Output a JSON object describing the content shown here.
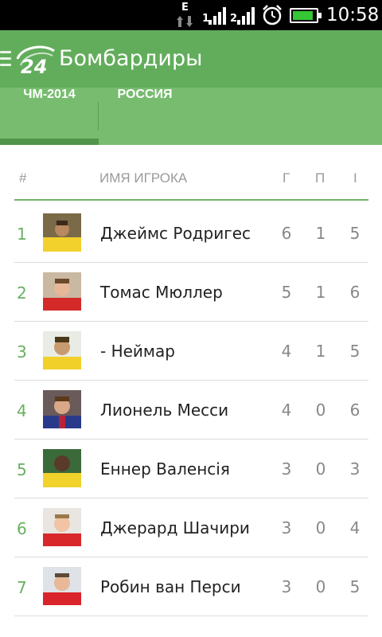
{
  "status_bar": {
    "network_type": "E",
    "sim1_label": "1",
    "sim2_label": "2",
    "time": "10:58",
    "battery_level": 0.9,
    "icons": [
      "data-activity-icon",
      "signal-icon",
      "signal-icon",
      "alarm-icon",
      "battery-icon"
    ]
  },
  "app_bar": {
    "title": "Бомбардиры",
    "logo": "24-logo"
  },
  "tabs": [
    {
      "label": "ЧМ-2014",
      "selected": true
    },
    {
      "label": "РОССИЯ",
      "selected": false
    }
  ],
  "table": {
    "headers": {
      "number": "#",
      "name": "ИМЯ ИГРОКА",
      "goals": "Г",
      "assists": "П",
      "games": "I"
    },
    "rows": [
      {
        "pos": "1",
        "name": "Джеймс Родригес",
        "goals": "6",
        "assists": "1",
        "games": "5"
      },
      {
        "pos": "2",
        "name": "Томас Мюллер",
        "goals": "5",
        "assists": "1",
        "games": "6"
      },
      {
        "pos": "3",
        "name": "- Неймар",
        "goals": "4",
        "assists": "1",
        "games": "5"
      },
      {
        "pos": "4",
        "name": "Лионель Месси",
        "goals": "4",
        "assists": "0",
        "games": "6"
      },
      {
        "pos": "5",
        "name": "Еннер Валенсія",
        "goals": "3",
        "assists": "0",
        "games": "3"
      },
      {
        "pos": "6",
        "name": "Джерард Шачири",
        "goals": "3",
        "assists": "0",
        "games": "4"
      },
      {
        "pos": "7",
        "name": "Робин ван Перси",
        "goals": "3",
        "assists": "0",
        "games": "5"
      }
    ]
  },
  "colors": {
    "app_bar": "#62ad5b",
    "tab_bar": "#77bc6f",
    "accent": "#68b061"
  }
}
